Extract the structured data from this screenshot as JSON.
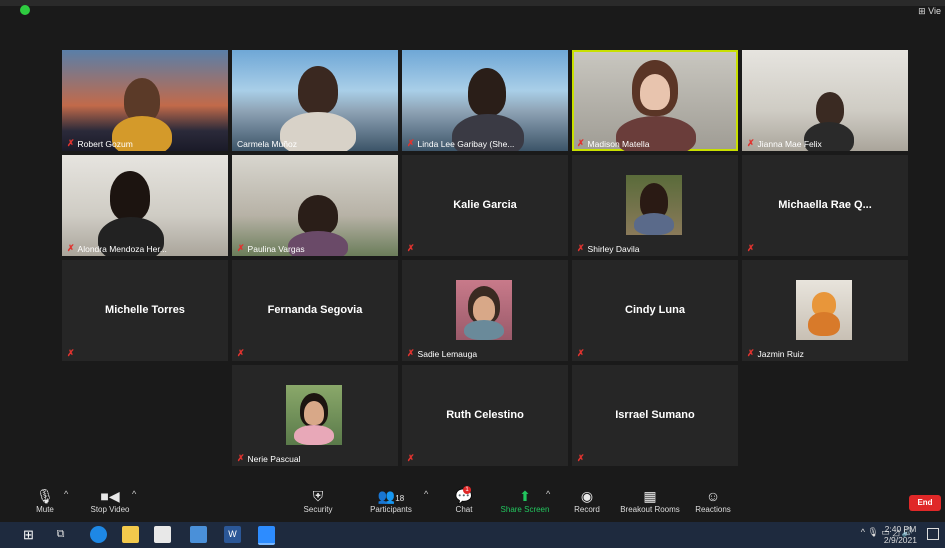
{
  "window": {
    "view_label": "Vie"
  },
  "participants": [
    {
      "name": "Robert Gozum",
      "label": "Robert Gozum",
      "video": true
    },
    {
      "name": "Carmela Muñoz",
      "label": "Carmela Muñoz",
      "video": true
    },
    {
      "name": "Linda Lee Garibay",
      "label": "Linda Lee Garibay (She...",
      "video": true
    },
    {
      "name": "Madison Matella",
      "label": "Madison Matella",
      "video": true,
      "active_speaker": true
    },
    {
      "name": "Jianna Mae Felix",
      "label": "Jianna Mae Felix",
      "video": true
    },
    {
      "name": "Alondra Mendoza",
      "label": "Alondra Mendoza Her...",
      "video": true
    },
    {
      "name": "Paulina Vargas",
      "label": "Paulina Vargas",
      "video": true
    },
    {
      "name": "Kalie Garcia",
      "label": "Kalie Garcia",
      "video": false
    },
    {
      "name": "Shirley Davila",
      "label": "Shirley Davila",
      "video": false,
      "photo": true
    },
    {
      "name": "Michaella Rae Q...",
      "label": "Michaella Rae Q...",
      "video": false
    },
    {
      "name": "Michelle Torres",
      "label": "Michelle Torres",
      "video": false
    },
    {
      "name": "Fernanda Segovia",
      "label": "Fernanda Segovia",
      "video": false
    },
    {
      "name": "Sadie Lemauga",
      "label": "Sadie Lemauga",
      "video": false,
      "photo": true
    },
    {
      "name": "Cindy Luna",
      "label": "Cindy Luna",
      "video": false
    },
    {
      "name": "Jazmin Ruiz",
      "label": "Jazmin Ruiz",
      "video": false,
      "photo": true
    },
    {
      "name": "Nerie Pascual",
      "label": "Nerie Pascual",
      "video": false,
      "photo": true
    },
    {
      "name": "Ruth Celestino",
      "label": "Ruth Celestino",
      "video": false
    },
    {
      "name": "Isrrael Sumano",
      "label": "Isrrael Sumano",
      "video": false
    }
  ],
  "toolbar": {
    "mute": "Mute",
    "stop_video": "Stop Video",
    "security": "Security",
    "participants": "Participants",
    "participants_count": "18",
    "chat": "Chat",
    "chat_badge": "1",
    "share_screen": "Share Screen",
    "record": "Record",
    "breakout_rooms": "Breakout Rooms",
    "reactions": "Reactions",
    "end": "End"
  },
  "taskbar": {
    "time": "2:40 PM",
    "date": "2/9/2021"
  },
  "colors": {
    "active_speaker_border": "#c8e000",
    "share_screen": "#22c55e",
    "end": "#e02828",
    "mic_off": "#e0332f"
  }
}
